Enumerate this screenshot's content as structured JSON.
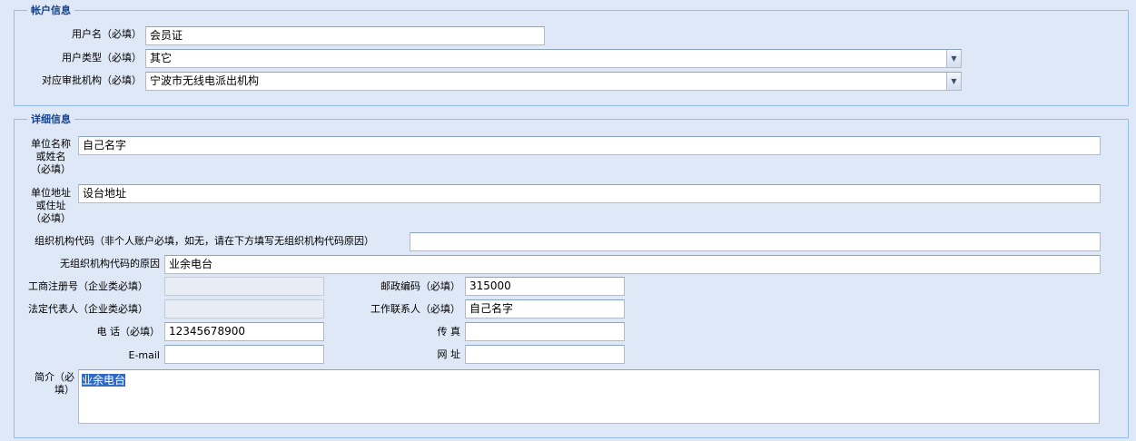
{
  "account": {
    "legend": "帐户信息",
    "username": {
      "label": "用户名（必填）",
      "value": "会员证"
    },
    "user_type": {
      "label": "用户类型（必填）",
      "value": "其它"
    },
    "agency": {
      "label": "对应审批机构（必填）",
      "value": "宁波市无线电派出机构"
    }
  },
  "details": {
    "legend": "详细信息",
    "org_name": {
      "label_lines": [
        "单位名称",
        "或姓名",
        "（必填）"
      ],
      "value": "自己名字"
    },
    "address": {
      "label_lines": [
        "单位地址",
        "或住址",
        "（必填）"
      ],
      "value": "设台地址"
    },
    "org_code": {
      "label": "组织机构代码（非个人账户必填，如无，请在下方填写无组织机构代码原因）",
      "value": ""
    },
    "no_code_reason": {
      "label": "无组织机构代码的原因",
      "value": "业余电台"
    },
    "biz_reg_no": {
      "label": "工商注册号（企业类必填）",
      "value": ""
    },
    "postcode": {
      "label": "邮政编码（必填）",
      "value": "315000"
    },
    "legal_rep": {
      "label": "法定代表人（企业类必填）",
      "value": ""
    },
    "contact": {
      "label": "工作联系人（必填）",
      "value": "自己名字"
    },
    "phone": {
      "label": "电 话（必填）",
      "value": "12345678900"
    },
    "fax": {
      "label": "传 真",
      "value": ""
    },
    "email": {
      "label": "E-mail",
      "value": ""
    },
    "website": {
      "label": "网 址",
      "value": ""
    },
    "intro": {
      "label_lines": [
        "简介（必",
        "填）"
      ],
      "value": "业余电台"
    }
  },
  "icons": {
    "dropdown": "chevron-down-icon"
  }
}
